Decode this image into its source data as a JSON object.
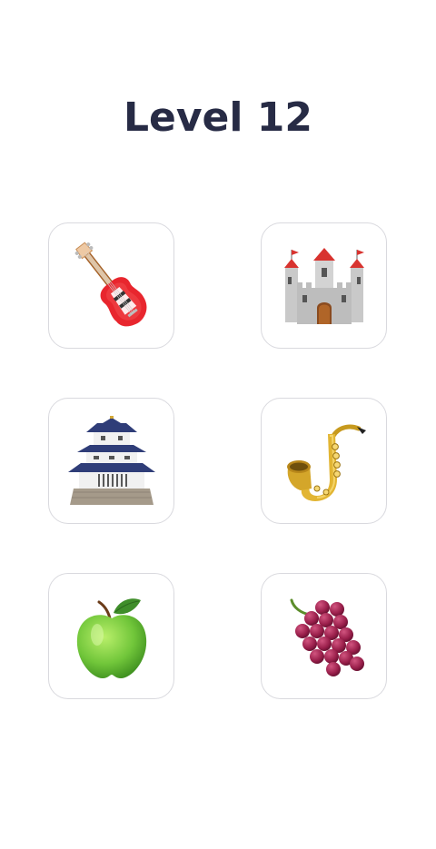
{
  "header": {
    "level_title": "Level 12"
  },
  "cards": [
    {
      "icon": "electric-guitar-icon"
    },
    {
      "icon": "european-castle-icon"
    },
    {
      "icon": "japanese-castle-icon"
    },
    {
      "icon": "saxophone-icon"
    },
    {
      "icon": "green-apple-icon"
    },
    {
      "icon": "grapes-icon"
    }
  ],
  "colors": {
    "title": "#272b45",
    "card_border": "#d9d9de",
    "background": "#ffffff"
  }
}
